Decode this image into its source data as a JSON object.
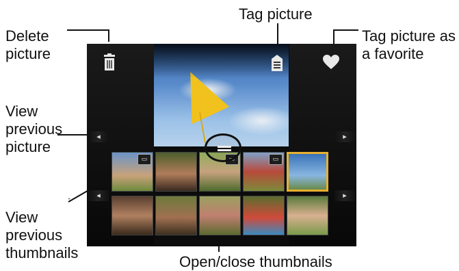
{
  "callouts": {
    "delete": "Delete\npicture",
    "tag": "Tag picture",
    "favorite": "Tag picture as\na favorite",
    "view_prev_picture": "View\nprevious\npicture",
    "view_prev_thumbs": "View\nprevious\nthumbnails",
    "open_close": "Open/close thumbnails"
  },
  "icons": {
    "delete": "trash-icon",
    "tag": "tag-icon",
    "favorite": "heart-icon",
    "prev_picture": "left-arrow-icon",
    "next_picture": "right-arrow-icon",
    "prev_thumbs": "left-arrow-icon",
    "next_thumbs": "right-arrow-icon",
    "video": "video-camera-icon"
  },
  "glyphs": {
    "trash": "🗑",
    "tag": "☰",
    "heart": "♥",
    "left": "◂",
    "right": "▸",
    "video": "▭"
  },
  "colors": {
    "selected_border": "#e8b030",
    "screen_bg": "#0c0c0c"
  },
  "thumbnails": [
    {
      "row": 1,
      "video": true,
      "selected": false
    },
    {
      "row": 1,
      "video": false,
      "selected": false
    },
    {
      "row": 1,
      "video": true,
      "selected": false
    },
    {
      "row": 1,
      "video": true,
      "selected": false
    },
    {
      "row": 1,
      "video": false,
      "selected": true
    },
    {
      "row": 2,
      "video": false,
      "selected": false
    },
    {
      "row": 2,
      "video": false,
      "selected": false
    },
    {
      "row": 2,
      "video": false,
      "selected": false
    },
    {
      "row": 2,
      "video": false,
      "selected": false
    },
    {
      "row": 2,
      "video": false,
      "selected": false
    }
  ]
}
